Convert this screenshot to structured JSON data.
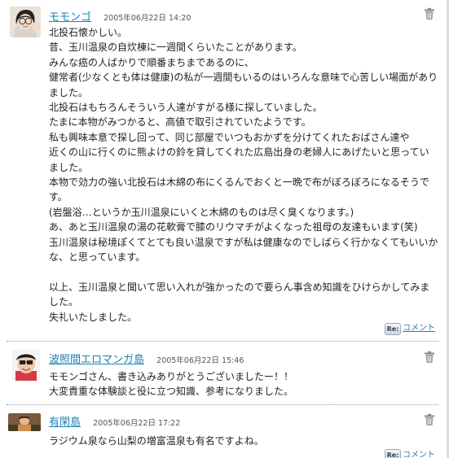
{
  "comments": [
    {
      "author": "モモンゴ",
      "date": "2005年06月22日 14:20",
      "lines": [
        "北投石懐かしい。",
        "昔、玉川温泉の自炊棟に一週間くらいたことがあります。",
        "みんな癌の人ばかりで順番まちまであるのに、",
        "健常者(少なくとも体は健康)の私が一週間もいるのはいろんな意味で心苦しい場面がありました。",
        "北投石はもちろんそういう人達がすがる様に探していました。",
        "たまに本物がみつかると、高値で取引されていたようです。",
        "私も興味本意で探し回って、同じ部屋でいつもおかずを分けてくれたおばさん達や",
        "近くの山に行くのに熊よけの鈴を貸してくれた広島出身の老婦人にあげたいと思っていました。",
        "本物で効力の強い北投石は木綿の布にくるんでおくと一晩で布がぼろぼろになるそうです。",
        "(岩盤浴…というか玉川温泉にいくと木綿のものは尽く臭くなります。)",
        "あ、あと玉川温泉の湯の花軟膏で膝のリウマチがよくなった祖母の友達もいます(笑)",
        "玉川温泉は秘境ぽくてとても良い温泉ですが私は健康なのでしばらく行かなくてもいいかな、と思っています。",
        "",
        "以上、玉川温泉と聞いて思い入れが強かったので要らん事含め知識をひけらかしてみました。",
        "失礼いたしました。"
      ],
      "reply_label": "コメント"
    },
    {
      "author": "波照間エロマンガ島",
      "date": "2005年06月22日 15:46",
      "lines": [
        "モモンゴさん、書き込みありがとうございましたー！！",
        "大変貴重な体験談と役に立つ知識、参考になりました。"
      ],
      "reply_label": "コメント"
    },
    {
      "author": "有閑島",
      "date": "2005年06月22日 17:22",
      "lines": [
        "ラジウム泉なら山梨の増富温泉も有名ですよね。"
      ],
      "reply_label": "コメント"
    }
  ],
  "icons": {
    "reply": "re-reply-icon",
    "delete": "trash-icon"
  },
  "re_text": "Re:",
  "colors": {
    "link": "#1b7fb0",
    "text": "#222222",
    "separator": "#999999"
  }
}
